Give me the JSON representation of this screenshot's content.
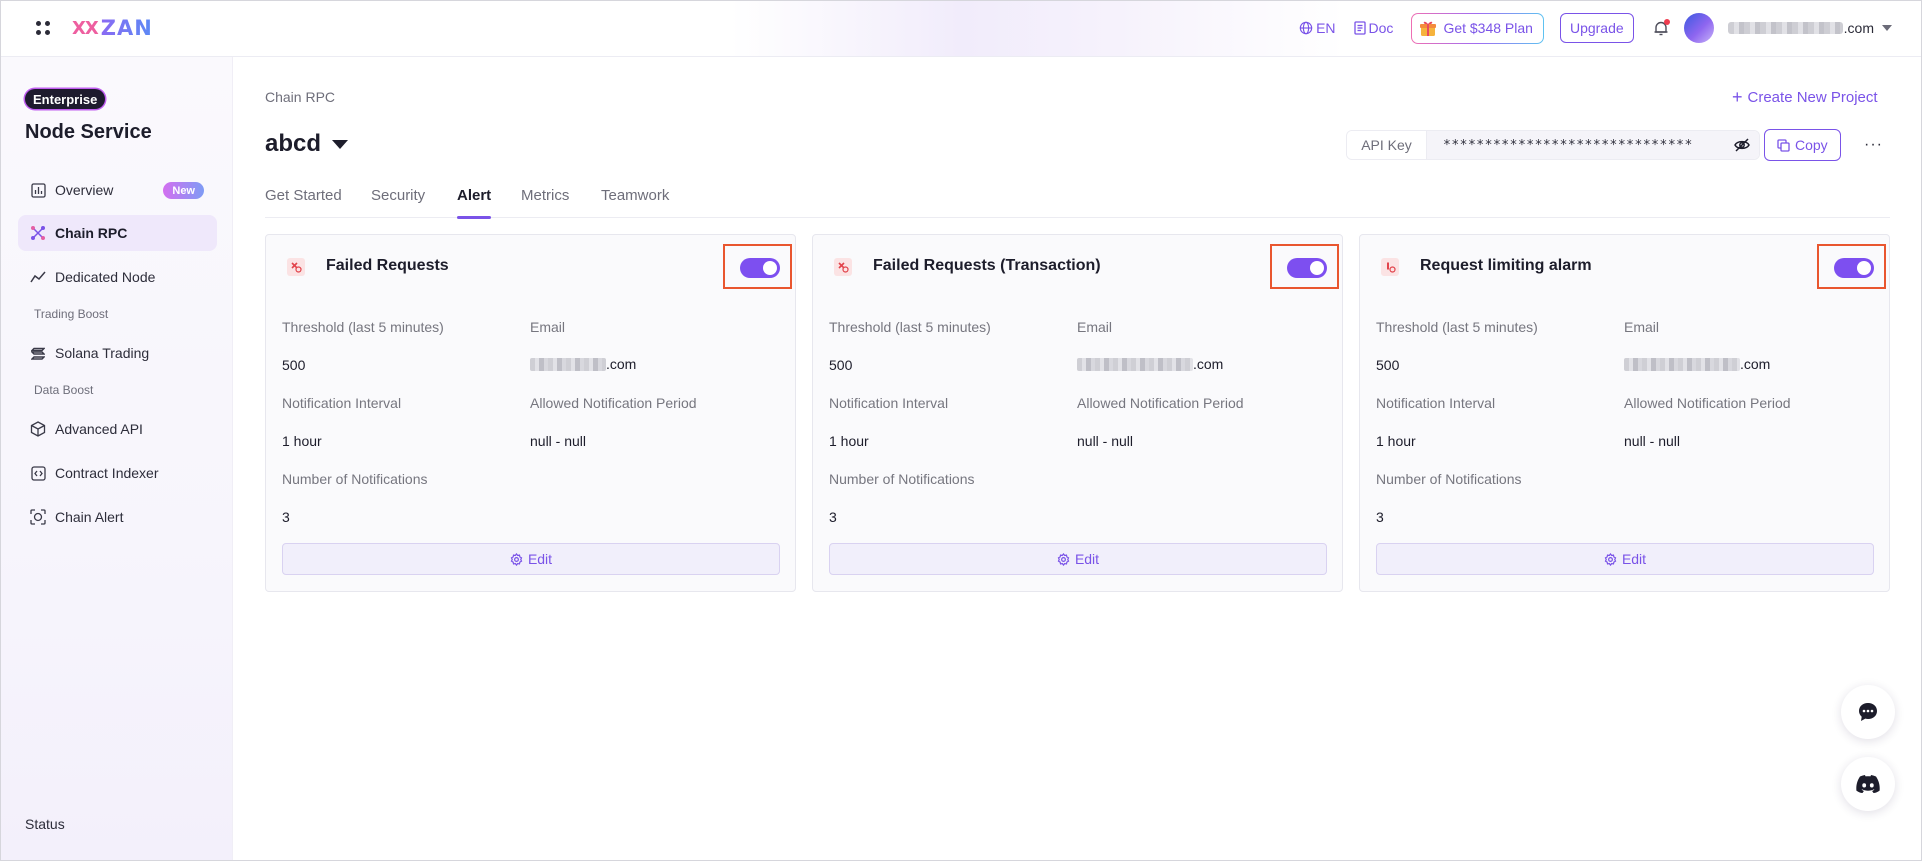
{
  "topbar": {
    "logo_mark": "XX",
    "logo_text": "ZAN",
    "lang": "EN",
    "doc": "Doc",
    "promo": "Get $348 Plan",
    "upgrade": "Upgrade",
    "email_suffix": ".com"
  },
  "sidebar": {
    "badge": "Enterprise",
    "title": "Node Service",
    "items": [
      {
        "label": "Overview",
        "badge": "New"
      },
      {
        "label": "Chain RPC"
      },
      {
        "label": "Dedicated Node"
      },
      {
        "label": "Solana Trading"
      },
      {
        "label": "Advanced API"
      },
      {
        "label": "Contract Indexer"
      },
      {
        "label": "Chain Alert"
      }
    ],
    "groups": [
      "Trading Boost",
      "Data Boost"
    ],
    "status": "Status"
  },
  "main": {
    "breadcrumb": "Chain RPC",
    "create_project": "Create New Project",
    "project_name": "abcd",
    "api_key_label": "API Key",
    "api_key_value": "******************************",
    "copy": "Copy",
    "more": "···",
    "tabs": [
      "Get Started",
      "Security",
      "Alert",
      "Metrics",
      "Teamwork"
    ],
    "active_tab": "Alert"
  },
  "cards": [
    {
      "title": "Failed Requests",
      "enabled": true,
      "threshold_label": "Threshold (last 5 minutes)",
      "threshold": "500",
      "email_label": "Email",
      "email_suffix": ".com",
      "interval_label": "Notification Interval",
      "interval": "1 hour",
      "period_label": "Allowed Notification Period",
      "period": "null - null",
      "count_label": "Number of Notifications",
      "count": "3",
      "edit": "Edit"
    },
    {
      "title": "Failed Requests (Transaction)",
      "enabled": true,
      "threshold_label": "Threshold (last 5 minutes)",
      "threshold": "500",
      "email_label": "Email",
      "email_suffix": ".com",
      "interval_label": "Notification Interval",
      "interval": "1 hour",
      "period_label": "Allowed Notification Period",
      "period": "null - null",
      "count_label": "Number of Notifications",
      "count": "3",
      "edit": "Edit"
    },
    {
      "title": "Request limiting alarm",
      "enabled": true,
      "threshold_label": "Threshold (last 5 minutes)",
      "threshold": "500",
      "email_label": "Email",
      "email_suffix": ".com",
      "interval_label": "Notification Interval",
      "interval": "1 hour",
      "period_label": "Allowed Notification Period",
      "period": "null - null",
      "count_label": "Number of Notifications",
      "count": "3",
      "edit": "Edit"
    }
  ],
  "colors": {
    "accent": "#7a53e8",
    "toggle_on": "#7d4ff0",
    "highlight_frame": "#e9562f",
    "alert_icon": "#e2434b"
  },
  "icons": {
    "apps": "apps-grid-icon",
    "lang": "globe-icon",
    "doc": "document-icon",
    "promo": "gift-icon",
    "bell": "bell-icon",
    "eye": "eye-off-icon",
    "copy": "copy-icon",
    "edit": "gear-icon",
    "chat": "chat-bubble-icon",
    "discord": "discord-icon"
  }
}
